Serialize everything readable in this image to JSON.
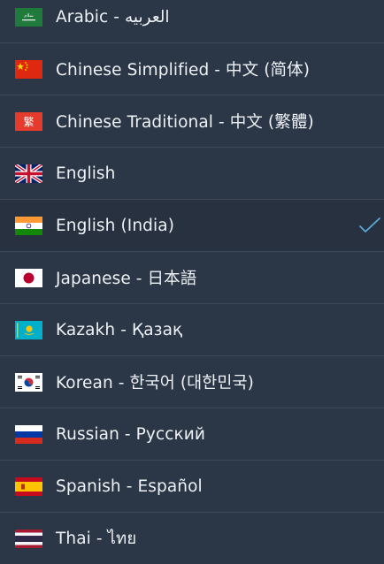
{
  "languages": [
    {
      "label": "Arabic - العربيه",
      "flag": "saudi-arabia-flag-icon"
    },
    {
      "label": "Chinese Simplified - 中文 (简体)",
      "flag": "china-flag-icon"
    },
    {
      "label": "Chinese Traditional - 中文 (繁體)",
      "flag": "traditional-chinese-flag-icon"
    },
    {
      "label": "English",
      "flag": "uk-flag-icon"
    },
    {
      "label": "English (India)",
      "flag": "india-flag-icon"
    },
    {
      "label": "Japanese - 日本語",
      "flag": "japan-flag-icon"
    },
    {
      "label": "Kazakh - Қазақ",
      "flag": "kazakhstan-flag-icon"
    },
    {
      "label": "Korean - 한국어 (대한민국)",
      "flag": "south-korea-flag-icon"
    },
    {
      "label": "Russian - Русский",
      "flag": "russia-flag-icon"
    },
    {
      "label": "Spanish - Español",
      "flag": "spain-flag-icon"
    },
    {
      "label": "Thai - ไทย",
      "flag": "thailand-flag-icon"
    }
  ],
  "selected_language": "English (India)",
  "colors": {
    "background": "#2b3646",
    "divider": "#3e4a5b",
    "text": "#eef1f5",
    "checkmark": "#5aa9d6"
  },
  "selected_icon": "checkmark-icon"
}
